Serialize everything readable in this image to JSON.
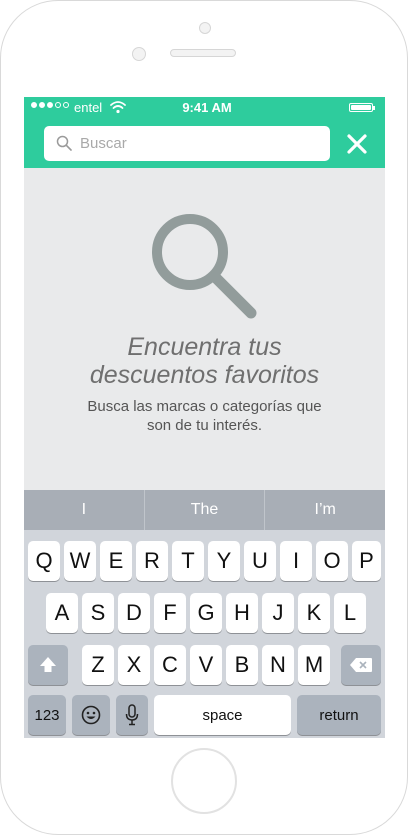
{
  "status_bar": {
    "carrier": "entel",
    "time": "9:41 AM",
    "signal_filled": 3,
    "signal_total": 5
  },
  "search": {
    "placeholder": "Buscar",
    "icon": "search-icon",
    "close_icon": "close-icon"
  },
  "empty_state": {
    "icon": "search-icon",
    "title_line1": "Encuentra tus",
    "title_line2": "descuentos favoritos",
    "desc_line1": "Busca las marcas o categorías que",
    "desc_line2": "son de tu interés."
  },
  "keyboard": {
    "suggestions": [
      "I",
      "The",
      "I’m"
    ],
    "row1": [
      "Q",
      "W",
      "E",
      "R",
      "T",
      "Y",
      "U",
      "I",
      "O",
      "P"
    ],
    "row2": [
      "A",
      "S",
      "D",
      "F",
      "G",
      "H",
      "J",
      "K",
      "L"
    ],
    "row3": [
      "Z",
      "X",
      "C",
      "V",
      "B",
      "N",
      "M"
    ],
    "shift_icon": "shift-icon",
    "delete_icon": "backspace-icon",
    "numbers_label": "123",
    "emoji_icon": "emoji-icon",
    "mic_icon": "microphone-icon",
    "space_label": "space",
    "return_label": "return"
  },
  "colors": {
    "accent": "#2ecc9d",
    "screen_background": "#e9eaeb",
    "icon_gray": "#929c9b",
    "keyboard_background": "#d1d5db"
  }
}
